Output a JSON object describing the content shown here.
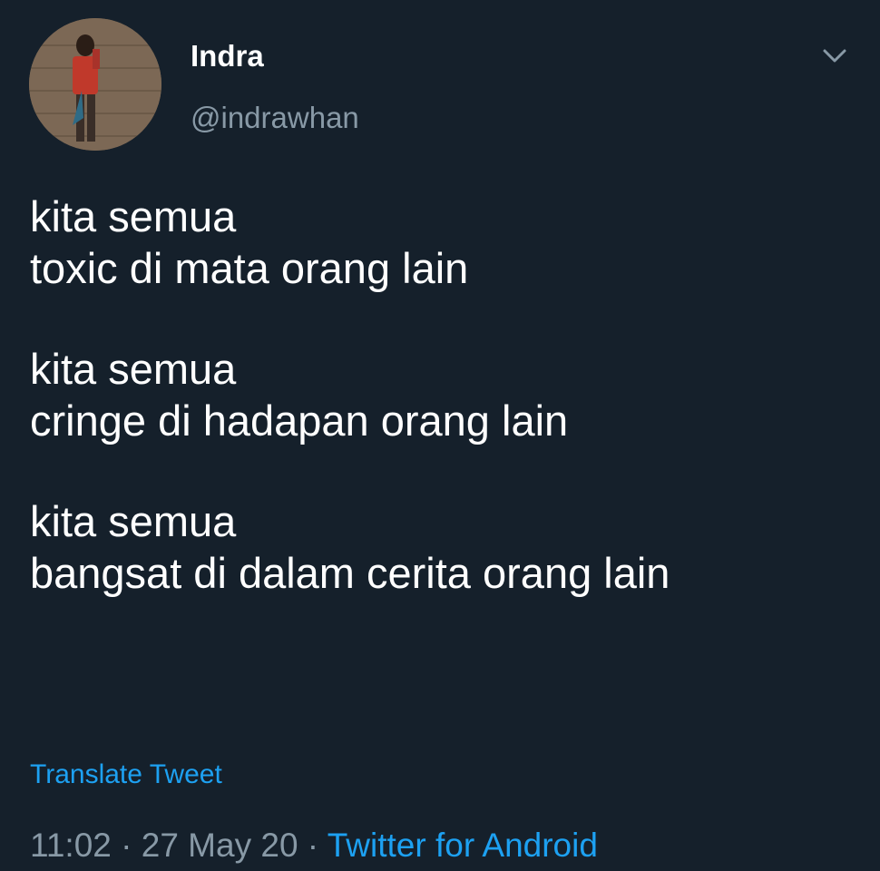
{
  "colors": {
    "background": "#15202b",
    "primary_text": "#ffffff",
    "secondary_text": "#8899a6",
    "accent": "#1da1f2"
  },
  "user": {
    "display_name": "Indra",
    "handle": "@indrawhan",
    "avatar": "avatar"
  },
  "menu": {
    "icon": "chevron-down-icon"
  },
  "tweet": {
    "stanzas": [
      {
        "lines": [
          "kita semua",
          "toxic di mata orang lain"
        ]
      },
      {
        "lines": [
          "kita semua",
          "cringe di hadapan orang lain"
        ]
      },
      {
        "lines": [
          "kita semua",
          "bangsat di dalam cerita orang lain"
        ]
      }
    ],
    "translate_label": "Translate Tweet"
  },
  "meta": {
    "time": "11:02",
    "separator": " · ",
    "date": "27 May 20",
    "source": "Twitter for Android"
  }
}
